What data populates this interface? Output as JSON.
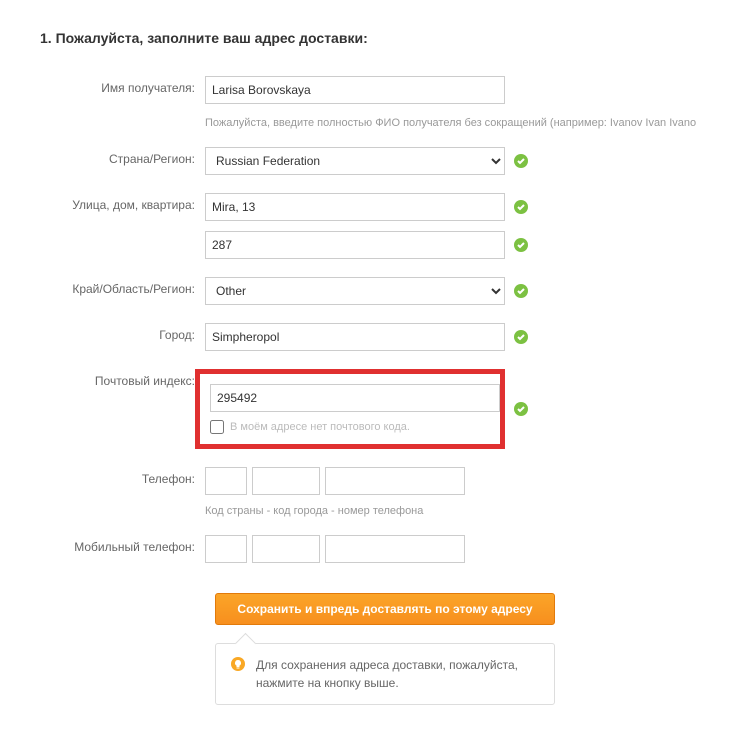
{
  "heading": "1. Пожалуйста, заполните ваш адрес доставки:",
  "fields": {
    "recipient": {
      "label": "Имя получателя:",
      "value": "Larisa Borovskaya",
      "hint": "Пожалуйста, введите полностью ФИО получателя без сокращений (например: Ivanov Ivan Ivano"
    },
    "country": {
      "label": "Страна/Регион:",
      "value": "Russian Federation"
    },
    "street": {
      "label": "Улица, дом, квартира:",
      "value": "Mira, 13",
      "value2": "287"
    },
    "region": {
      "label": "Край/Область/Регион:",
      "value": "Other"
    },
    "city": {
      "label": "Город:",
      "value": "Simpheropol"
    },
    "postcode": {
      "label": "Почтовый индекс:",
      "value": "295492",
      "checkbox_label": "В моём адресе нет почтового кода."
    },
    "phone": {
      "label": "Телефон:",
      "hint": "Код страны - код города - номер телефона"
    },
    "mobile": {
      "label": "Мобильный телефон:"
    }
  },
  "submit": {
    "button": "Сохранить и впредь доставлять по этому адресу",
    "info": "Для сохранения адреса доставки, пожалуйста, нажмите на кнопку выше."
  }
}
